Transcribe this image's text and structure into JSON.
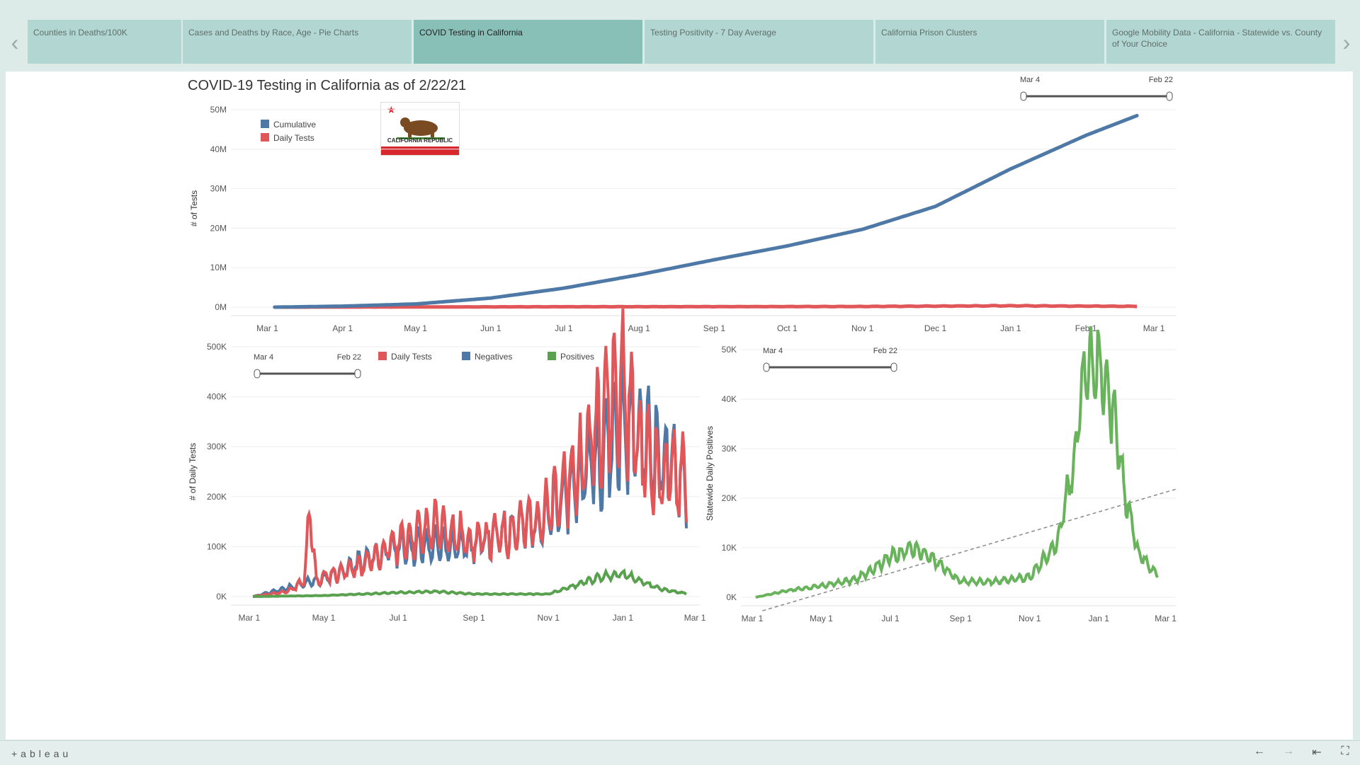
{
  "tabs": [
    {
      "label": "Counties in Deaths/100K",
      "active": false
    },
    {
      "label": "Cases and Deaths by Race, Age - Pie Charts",
      "active": false
    },
    {
      "label": "COVID Testing in California",
      "active": true
    },
    {
      "label": "Testing Positivity - 7 Day Average",
      "active": false
    },
    {
      "label": "California Prison Clusters",
      "active": false
    },
    {
      "label": "Google Mobility Data - California - Statewide vs. County of Your Choice",
      "active": false
    }
  ],
  "nav": {
    "prev": "‹",
    "next": "›"
  },
  "dashboard": {
    "title": "COVID-19 Testing in California as of 2/22/21"
  },
  "flag": {
    "text": "CALIFORNIA REPUBLIC"
  },
  "footer": {
    "brand": "+ableau",
    "back": "←",
    "forward": "→",
    "reset": "⇤",
    "fullscreen": "⛶"
  },
  "colors": {
    "cumulative": "#4e79a7",
    "daily": "#e15759",
    "negatives": "#4e79a7",
    "positives": "#59a14f",
    "positives_right": "#6ab35d",
    "tab_active": "#88bfb7",
    "tab": "#b2d6d1"
  },
  "chart_data": [
    {
      "type": "line",
      "title": "",
      "ylabel": "# of Tests",
      "xlabel": "",
      "ylim": [
        0,
        50000000
      ],
      "yticks": [
        "0M",
        "10M",
        "20M",
        "30M",
        "40M",
        "50M"
      ],
      "xticks": [
        "Mar 1",
        "Apr 1",
        "May 1",
        "Jun 1",
        "Jul 1",
        "Aug 1",
        "Sep 1",
        "Oct 1",
        "Nov 1",
        "Dec 1",
        "Jan 1",
        "Feb 1",
        "Mar 1"
      ],
      "legend": [
        "Cumulative",
        "Daily Tests"
      ],
      "legend_position": "top-left",
      "slider": {
        "start": "Mar 4",
        "end": "Feb 22"
      },
      "series": [
        {
          "name": "Cumulative",
          "x": [
            "2020-03-04",
            "2020-04-01",
            "2020-05-01",
            "2020-06-01",
            "2020-07-01",
            "2020-08-01",
            "2020-09-01",
            "2020-10-01",
            "2020-11-01",
            "2020-12-01",
            "2021-01-01",
            "2021-02-01",
            "2021-02-22"
          ],
          "values": [
            0,
            250000,
            800000,
            2300000,
            4800000,
            8200000,
            12000000,
            15500000,
            19700000,
            25500000,
            35000000,
            43500000,
            48500000
          ]
        },
        {
          "name": "Daily Tests",
          "x": [
            "2020-03-04",
            "2020-05-01",
            "2020-07-01",
            "2020-09-01",
            "2020-11-01",
            "2021-01-01",
            "2021-02-22"
          ],
          "values": [
            0,
            40000,
            100000,
            120000,
            160000,
            350000,
            200000
          ]
        }
      ]
    },
    {
      "type": "line",
      "title": "",
      "ylabel": "# of Daily Tests",
      "xlabel": "",
      "ylim": [
        0,
        500000
      ],
      "yticks": [
        "0K",
        "100K",
        "200K",
        "300K",
        "400K",
        "500K"
      ],
      "xticks": [
        "Mar 1",
        "May 1",
        "Jul 1",
        "Sep 1",
        "Nov 1",
        "Jan 1",
        "Mar 1"
      ],
      "legend": [
        "Daily Tests",
        "Negatives",
        "Positives"
      ],
      "slider": {
        "start": "Mar 4",
        "end": "Feb 22"
      },
      "series": [
        {
          "name": "Daily Tests",
          "x": [
            "2020-03-04",
            "2020-04-01",
            "2020-04-15",
            "2020-04-20",
            "2020-04-25",
            "2020-05-01",
            "2020-06-01",
            "2020-07-01",
            "2020-08-01",
            "2020-09-01",
            "2020-10-01",
            "2020-11-01",
            "2020-12-01",
            "2020-12-15",
            "2021-01-01",
            "2021-01-15",
            "2021-02-01",
            "2021-02-22"
          ],
          "values": [
            0,
            10000,
            30000,
            170000,
            30000,
            40000,
            60000,
            110000,
            140000,
            110000,
            130000,
            170000,
            280000,
            380000,
            420000,
            300000,
            240000,
            250000
          ]
        },
        {
          "name": "Negatives",
          "x": [
            "2020-03-04",
            "2020-05-01",
            "2020-07-01",
            "2020-09-01",
            "2020-11-01",
            "2021-01-01",
            "2021-02-22"
          ],
          "values": [
            0,
            35000,
            100000,
            105000,
            160000,
            350000,
            230000
          ]
        },
        {
          "name": "Positives",
          "x": [
            "2020-03-04",
            "2020-05-01",
            "2020-07-01",
            "2020-08-01",
            "2020-09-01",
            "2020-11-01",
            "2020-12-15",
            "2021-01-01",
            "2021-02-01",
            "2021-02-22"
          ],
          "values": [
            0,
            2000,
            8000,
            10000,
            5000,
            5000,
            40000,
            45000,
            15000,
            6000
          ]
        }
      ]
    },
    {
      "type": "line",
      "title": "",
      "ylabel": "Statewide Daily Positives",
      "xlabel": "",
      "ylim": [
        0,
        55000
      ],
      "yticks": [
        "0K",
        "10K",
        "20K",
        "30K",
        "40K",
        "50K"
      ],
      "xticks": [
        "Mar 1",
        "May 1",
        "Jul 1",
        "Sep 1",
        "Nov 1",
        "Jan 1",
        "Mar 1"
      ],
      "slider": {
        "start": "Mar 4",
        "end": "Feb 22"
      },
      "trend_line": true,
      "series": [
        {
          "name": "Positives",
          "x": [
            "2020-03-04",
            "2020-04-01",
            "2020-05-01",
            "2020-06-01",
            "2020-07-01",
            "2020-07-20",
            "2020-08-10",
            "2020-09-01",
            "2020-10-01",
            "2020-11-01",
            "2020-11-25",
            "2020-12-10",
            "2020-12-20",
            "2021-01-05",
            "2021-01-15",
            "2021-01-25",
            "2021-02-05",
            "2021-02-22"
          ],
          "values": [
            0,
            1500,
            2500,
            4000,
            9000,
            11000,
            8000,
            3500,
            3500,
            4500,
            12000,
            30000,
            53000,
            50000,
            38000,
            22000,
            10000,
            5000
          ]
        }
      ]
    }
  ]
}
